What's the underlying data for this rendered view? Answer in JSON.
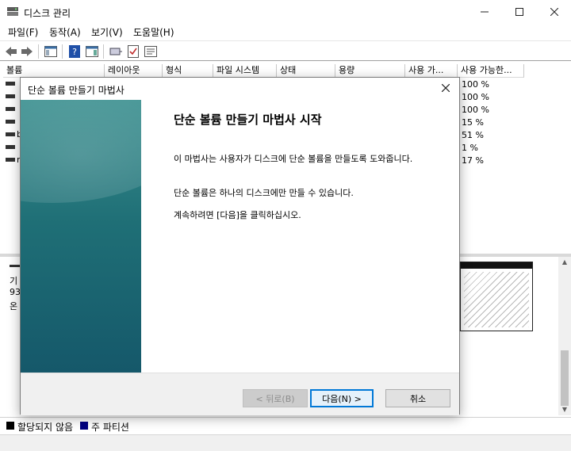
{
  "app": {
    "title": "디스크 관리",
    "min_icon": "minimize-icon",
    "max_icon": "maximize-icon",
    "close_icon": "close-icon"
  },
  "menu": [
    "파일(F)",
    "동작(A)",
    "보기(V)",
    "도움말(H)"
  ],
  "toolbar": [
    "back-arrow-icon",
    "forward-arrow-icon",
    "console-tree-icon",
    "help-icon",
    "action-pane-icon",
    "connect-icon",
    "checklist-icon",
    "properties-icon"
  ],
  "volume_table": {
    "columns": [
      "볼륨",
      "레이아웃",
      "형식",
      "파일 시스템",
      "상태",
      "용량",
      "사용 가...",
      "사용 가능한..."
    ],
    "row_letters": [
      "",
      "",
      "",
      "",
      "b",
      "",
      "n"
    ],
    "percents": [
      "100 %",
      "100 %",
      "100 %",
      "15 %",
      "51 %",
      "1 %",
      "17 %"
    ]
  },
  "disk_panel": {
    "lines": [
      "기",
      "93",
      "온"
    ]
  },
  "legend": [
    {
      "label": "할당되지 않음",
      "color": "#000000"
    },
    {
      "label": "주 파티션",
      "color": "#000080"
    }
  ],
  "wizard": {
    "title": "단순 볼륨 만들기 마법사",
    "heading": "단순 볼륨 만들기 마법사 시작",
    "p1": "이 마법사는 사용자가 디스크에 단순 볼륨을 만들도록 도와줍니다.",
    "p2": "단순 볼륨은 하나의 디스크에만 만들 수 있습니다.",
    "p3": "계속하려면 [다음]을 클릭하십시오.",
    "back": "< 뒤로(B)",
    "next": "다음(N) >",
    "cancel": "취소"
  }
}
